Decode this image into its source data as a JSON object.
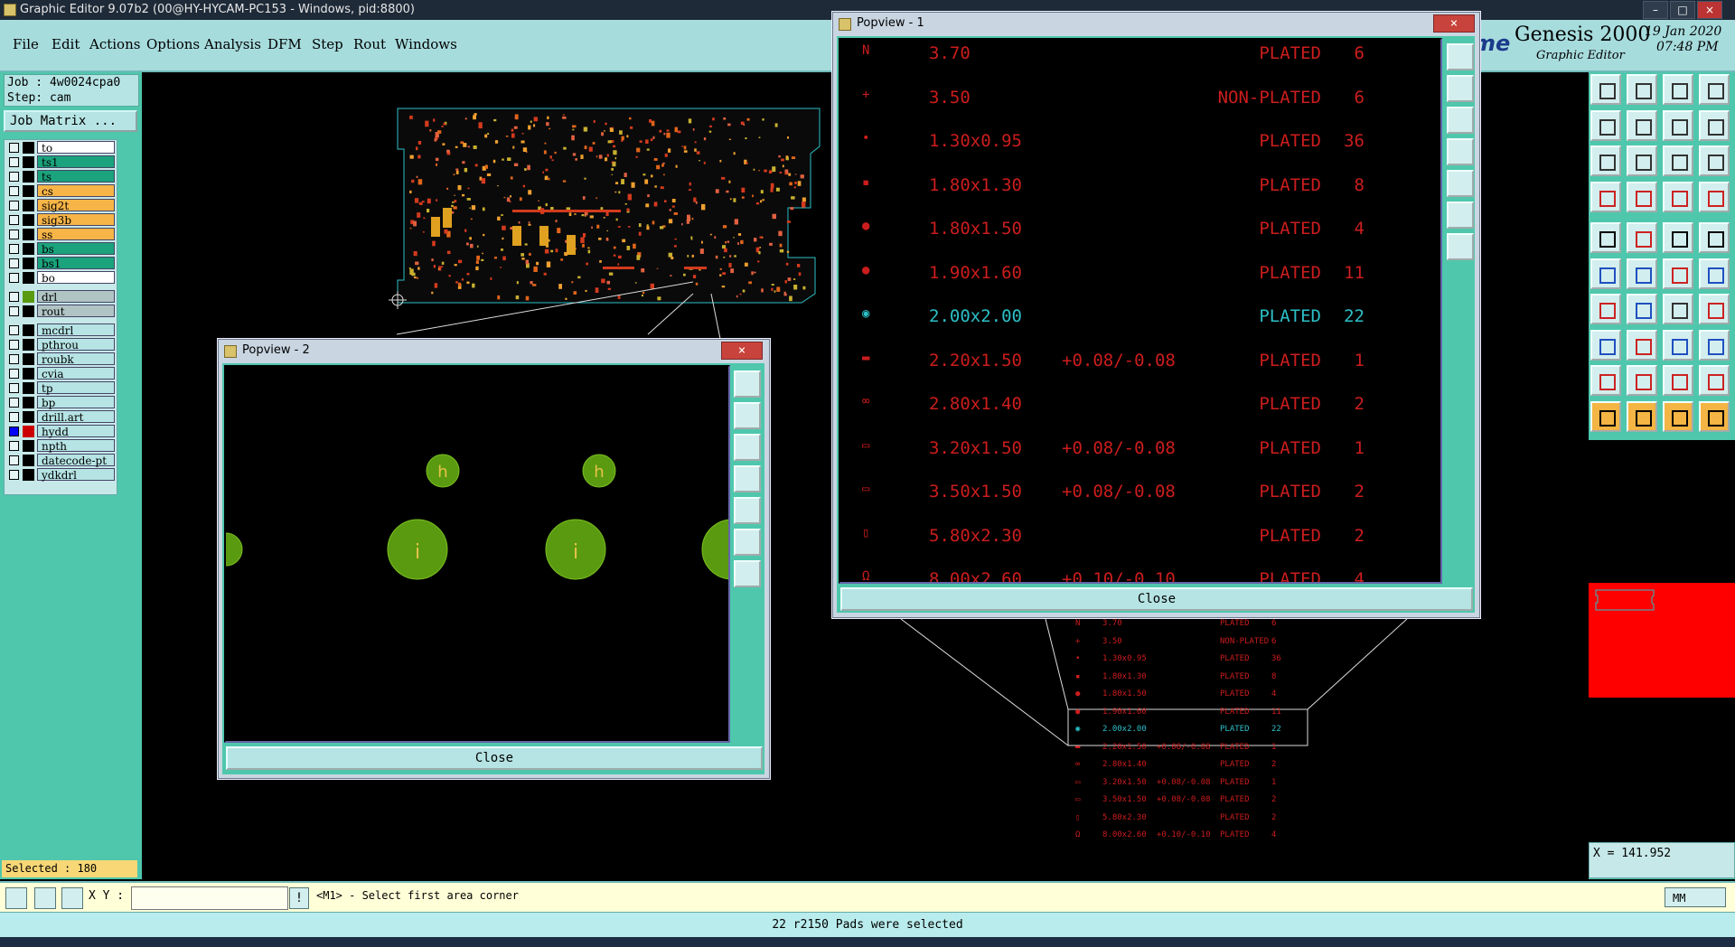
{
  "window": {
    "title": "Graphic Editor 9.07b2 (00@HY-HYCAM-PC153 - Windows, pid:8800)",
    "min_label": "–",
    "max_label": "□",
    "close_label": "×"
  },
  "menu": [
    "File",
    "Edit",
    "Actions",
    "Options",
    "Analysis",
    "DFM",
    "Step",
    "Rout",
    "Windows"
  ],
  "brand": {
    "partial": "me",
    "name": "Genesis 2000",
    "sub": "Graphic Editor",
    "date": "19 Jan 2020",
    "time": "07:48 PM"
  },
  "job": {
    "job_line": "Job : 4w0024cpa0",
    "step_line": "Step: cam",
    "matrix_button": "Job Matrix ..."
  },
  "layers": [
    {
      "name": "to",
      "color": "#ffffff"
    },
    {
      "name": "ts1",
      "color": "#1aa37c"
    },
    {
      "name": "ts",
      "color": "#1aa37c"
    },
    {
      "name": "cs",
      "color": "#f7b548"
    },
    {
      "name": "sig2t",
      "color": "#f7b548"
    },
    {
      "name": "sig3b",
      "color": "#f7b548"
    },
    {
      "name": "ss",
      "color": "#f7b548"
    },
    {
      "name": "bs",
      "color": "#1aa37c"
    },
    {
      "name": "bs1",
      "color": "#1aa37c"
    },
    {
      "name": "bo",
      "color": "#ffffff"
    },
    {
      "name": "drl",
      "color": "#b0c4c4"
    },
    {
      "name": "rout",
      "color": "#b0c4c4"
    },
    {
      "name": "mcdrl",
      "color": "#b6e4e4"
    },
    {
      "name": "pthrou",
      "color": "#b6e4e4"
    },
    {
      "name": "roubk",
      "color": "#b6e4e4"
    },
    {
      "name": "cvia",
      "color": "#b6e4e4"
    },
    {
      "name": "tp",
      "color": "#b6e4e4"
    },
    {
      "name": "bp",
      "color": "#b6e4e4"
    },
    {
      "name": "drill.art",
      "color": "#b6e4e4"
    },
    {
      "name": "hydd",
      "color": "#b6e4e4"
    },
    {
      "name": "npth",
      "color": "#b6e4e4"
    },
    {
      "name": "datecode-pt",
      "color": "#b6e4e4"
    },
    {
      "name": "ydkdrl",
      "color": "#b6e4e4"
    }
  ],
  "selected": "Selected : 180",
  "popview2": {
    "title": "Popview - 2",
    "close_x": "×",
    "close_button": "Close",
    "pad_labels": [
      "h",
      "h",
      "i",
      "i"
    ]
  },
  "popview1": {
    "title": "Popview - 1",
    "close_x": "×",
    "close_button": "Close",
    "rows": [
      {
        "sym": "N",
        "size": "3.70",
        "tol": "",
        "type": "PLATED",
        "count": "6"
      },
      {
        "sym": "+",
        "size": "3.50",
        "tol": "",
        "type": "NON-PLATED",
        "count": "6"
      },
      {
        "sym": "•",
        "size": "1.30x0.95",
        "tol": "",
        "type": "PLATED",
        "count": "36"
      },
      {
        "sym": "▪",
        "size": "1.80x1.30",
        "tol": "",
        "type": "PLATED",
        "count": "8"
      },
      {
        "sym": "●",
        "size": "1.80x1.50",
        "tol": "",
        "type": "PLATED",
        "count": "4"
      },
      {
        "sym": "●",
        "size": "1.90x1.60",
        "tol": "",
        "type": "PLATED",
        "count": "11"
      },
      {
        "sym": "◉",
        "size": "2.00x2.00",
        "tol": "",
        "type": "PLATED",
        "count": "22"
      },
      {
        "sym": "▬",
        "size": "2.20x1.50",
        "tol": "+0.08/-0.08",
        "type": "PLATED",
        "count": "1"
      },
      {
        "sym": "∞",
        "size": "2.80x1.40",
        "tol": "",
        "type": "PLATED",
        "count": "2"
      },
      {
        "sym": "▭",
        "size": "3.20x1.50",
        "tol": "+0.08/-0.08",
        "type": "PLATED",
        "count": "1"
      },
      {
        "sym": "▭",
        "size": "3.50x1.50",
        "tol": "+0.08/-0.08",
        "type": "PLATED",
        "count": "2"
      },
      {
        "sym": "▯",
        "size": "5.80x2.30",
        "tol": "",
        "type": "PLATED",
        "count": "2"
      },
      {
        "sym": "Ω",
        "size": "8.00x2.60",
        "tol": "+0.10/-0.10",
        "type": "PLATED",
        "count": "4"
      }
    ],
    "highlight_index": 6
  },
  "coord": {
    "x_readout": "X = 141.952"
  },
  "cmdline": {
    "xy_label": "X Y :",
    "xy_value": "",
    "prompt": "<M1> - Select first area corner",
    "units": "MM"
  },
  "status": "22 r2150 Pads were selected",
  "colors": {
    "panel_teal": "#4fc7ad",
    "menubar": "#a7dcdd",
    "plated_red": "#cc1d1d",
    "highlight_cyan": "#2cc0c8",
    "pad_green": "#5a9a10",
    "preview_red": "#ff0000"
  }
}
